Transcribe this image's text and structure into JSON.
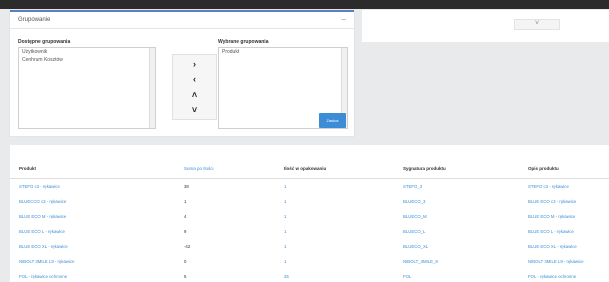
{
  "groupings": {
    "title": "Grupowanie",
    "collapse_icon": "minus-icon",
    "available_label": "Dostępne grupowania",
    "available_items": [
      "Użytkownik",
      "Cenhrum Kosztów"
    ],
    "selected_label": "Wybrane grupowania",
    "selected_items": [
      "Produkt"
    ],
    "buttons": {
      "add": "›",
      "remove": "‹",
      "up": "˄",
      "down": "˅"
    },
    "apply_label": "Zastos"
  },
  "right_panel": {
    "tab_icon": "chevron-down-icon",
    "tab_label": "˅"
  },
  "table": {
    "columns": [
      "Produkt",
      "Suma po Ilości",
      "Ilość w opakowaniu",
      "Sygnatura produktu",
      "Opis produktu"
    ],
    "rows": [
      [
        "STEFO c3 - rękawice",
        "38",
        "1",
        "STEFO_3",
        "STEFO c3 - rękawice"
      ],
      [
        "BLUECCO c3 - rękawice",
        "1",
        "1",
        "BLUECO_3",
        "BLUE ECO c3 - rękawice"
      ],
      [
        "BLUE ECO M - rękawice",
        "4",
        "1",
        "BLUECO_M",
        "BLUE ECO M - rękawice"
      ],
      [
        "BLUE ECO L - rękawice",
        "9",
        "1",
        "BLUECO_L",
        "BLUE ECO L - rękawice"
      ],
      [
        "BLUE ECO XL - rękawice",
        "-42",
        "1",
        "BLUECO_XL",
        "BLUE ECO XL - rękawice"
      ],
      [
        "NIBOLT 3MILE L9 - rękawice",
        "0",
        "1",
        "NIBOLT_3MILE_9",
        "NIBOLT 3MILE L9 - rękawice"
      ],
      [
        "FOL - rękawice ochronne",
        "5",
        "25",
        "FOL",
        "FOL - rękawice ochronne"
      ]
    ]
  }
}
